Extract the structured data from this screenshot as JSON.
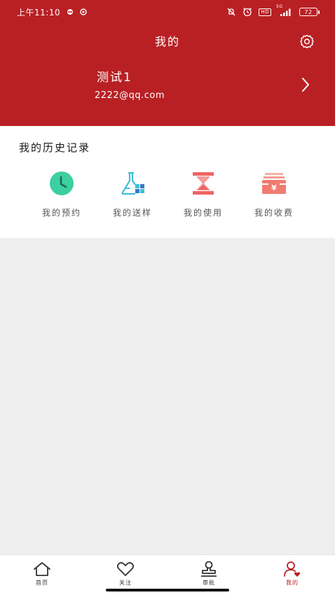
{
  "status_bar": {
    "time": "上午11:10",
    "network": "5G",
    "hd": "HD",
    "battery": "72"
  },
  "header": {
    "title": "我的",
    "settings_icon": "gear-icon",
    "user": {
      "name": "测试1",
      "email": "2222@qq.com"
    }
  },
  "history": {
    "title": "我的历史记录",
    "items": [
      {
        "label": "我的预约",
        "icon": "clock-icon",
        "color": "#3dcfa0"
      },
      {
        "label": "我的送样",
        "icon": "flask-icon",
        "color": "#3fc0d6"
      },
      {
        "label": "我的使用",
        "icon": "hourglass-icon",
        "color": "#f06464"
      },
      {
        "label": "我的收费",
        "icon": "yen-wallet-icon",
        "color": "#f27b70"
      }
    ]
  },
  "tabbar": {
    "tabs": [
      {
        "label": "首页",
        "icon": "home-icon"
      },
      {
        "label": "关注",
        "icon": "heart-icon"
      },
      {
        "label": "审批",
        "icon": "stamp-icon"
      },
      {
        "label": "我的",
        "icon": "user-icon",
        "active": true
      }
    ]
  },
  "colors": {
    "brand": "#b92024",
    "background": "#efefef"
  }
}
